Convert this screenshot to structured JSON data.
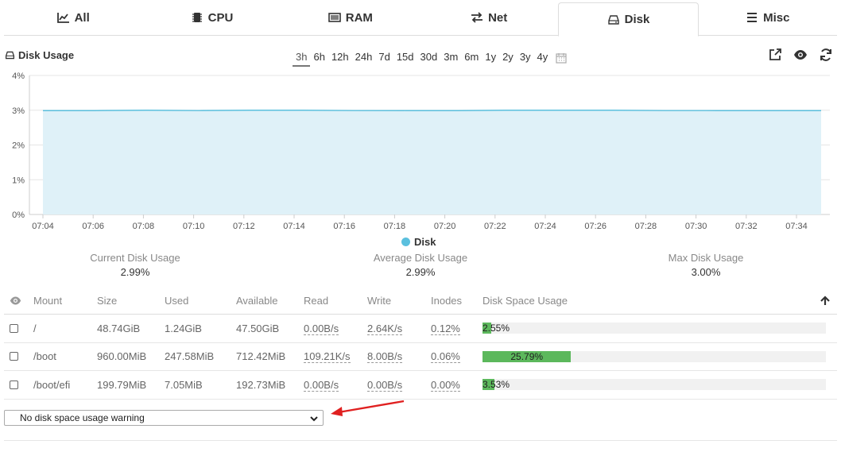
{
  "tabs": [
    {
      "label": "All",
      "icon": "line-chart-icon"
    },
    {
      "label": "CPU",
      "icon": "chip-icon"
    },
    {
      "label": "RAM",
      "icon": "memory-icon"
    },
    {
      "label": "Net",
      "icon": "exchange-icon"
    },
    {
      "label": "Disk",
      "icon": "hdd-icon",
      "active": true
    },
    {
      "label": "Misc",
      "icon": "bars-icon"
    }
  ],
  "panel": {
    "title": "Disk Usage",
    "ranges": [
      "3h",
      "6h",
      "12h",
      "24h",
      "7d",
      "15d",
      "30d",
      "3m",
      "6m",
      "1y",
      "2y",
      "3y",
      "4y"
    ],
    "active_range": "3h"
  },
  "chart_data": {
    "type": "area",
    "x": [
      "07:04",
      "07:06",
      "07:08",
      "07:10",
      "07:12",
      "07:14",
      "07:16",
      "07:18",
      "07:20",
      "07:22",
      "07:24",
      "07:26",
      "07:28",
      "07:30",
      "07:32",
      "07:34"
    ],
    "series": [
      {
        "name": "Disk",
        "values": [
          2.99,
          2.99,
          3.0,
          2.99,
          3.0,
          3.0,
          2.99,
          2.99,
          2.99,
          3.0,
          3.0,
          3.0,
          2.99,
          2.99,
          2.99,
          2.99
        ]
      }
    ],
    "y_ticks": [
      "0%",
      "1%",
      "2%",
      "3%",
      "4%"
    ],
    "ylim": [
      0,
      4
    ],
    "grid": true,
    "legend": "bottom-center",
    "color_line": "#5bc0de",
    "color_fill": "#dff1f8"
  },
  "stats": {
    "current": {
      "label": "Current Disk Usage",
      "value": "2.99%"
    },
    "average": {
      "label": "Average Disk Usage",
      "value": "2.99%"
    },
    "max": {
      "label": "Max Disk Usage",
      "value": "3.00%"
    }
  },
  "table": {
    "headers": [
      "Mount",
      "Size",
      "Used",
      "Available",
      "Read",
      "Write",
      "Inodes",
      "Disk Space Usage"
    ],
    "rows": [
      {
        "mount": "/",
        "size": "48.74GiB",
        "used": "1.24GiB",
        "available": "47.50GiB",
        "read": "0.00B/s",
        "write": "2.64K/s",
        "inodes": "0.12%",
        "usage_label": "2.55%",
        "usage_pct": 2.55
      },
      {
        "mount": "/boot",
        "size": "960.00MiB",
        "used": "247.58MiB",
        "available": "712.42MiB",
        "read": "109.21K/s",
        "write": "8.00B/s",
        "inodes": "0.06%",
        "usage_label": "25.79%",
        "usage_pct": 25.79
      },
      {
        "mount": "/boot/efi",
        "size": "199.79MiB",
        "used": "7.05MiB",
        "available": "192.73MiB",
        "read": "0.00B/s",
        "write": "0.00B/s",
        "inodes": "0.00%",
        "usage_label": "3.53%",
        "usage_pct": 3.53
      }
    ]
  },
  "warning_select": {
    "selected": "No disk space usage warning"
  },
  "colors": {
    "bar": "#5cb85c",
    "arrow": "#e02020"
  }
}
